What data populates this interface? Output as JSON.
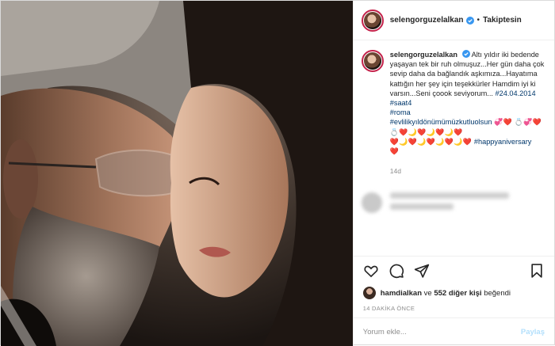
{
  "header": {
    "username": "selengorguzelalkan",
    "separator": "•",
    "follow_status": "Takiptesin"
  },
  "caption": {
    "username": "selengorguzelalkan",
    "text": "Altı yıldır iki bedende yaşayan tek bir ruh olmuşuz...Her gün daha çok sevip daha da bağlandık aşkımıza...Hayatıma kattığın her şey için teşekkürler Hamdim iyi ki varsın...Seni çoook seviyorum...",
    "tag_date": "#24.04.2014",
    "tag_saat": "#saat4",
    "tag_roma": "#roma",
    "tag_anniv": "#evlilikyıldönümümüzkutluolsun",
    "hearts_line1": "💞❤️ 💍💞❤️ 💍❤️🌙❤️🌙❤️🌙❤️",
    "hearts_line2": "❤️🌙❤️🌙❤️🌙❤️🌙❤️",
    "tag_happy": "#happyaniversary",
    "hearts_end": "❤️",
    "age": "14d"
  },
  "likes": {
    "user": "hamdialkan",
    "connector": "ve",
    "others": "552 diğer kişi",
    "suffix": "beğendi"
  },
  "time_ago": "14 DAKİKA ÖNCE",
  "comment_box": {
    "placeholder": "Yorum ekle...",
    "post_label": "Paylaş"
  },
  "colors": {
    "link": "#00376b",
    "verified": "#3897f0",
    "heart": "#d11c3a",
    "post_button": "#b2dffc"
  },
  "icons": [
    "heart-icon",
    "comment-icon",
    "share-icon",
    "bookmark-icon",
    "verified-badge-icon"
  ]
}
